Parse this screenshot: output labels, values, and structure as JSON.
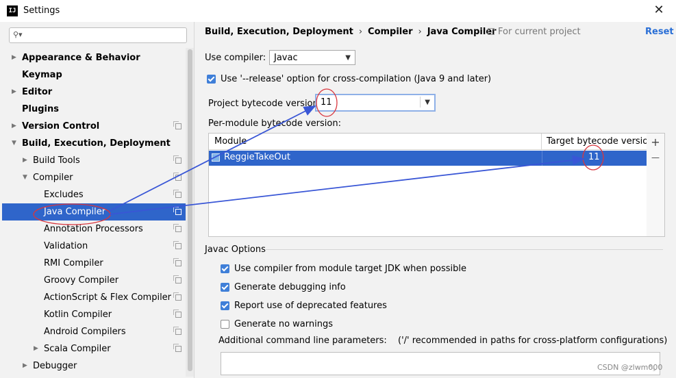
{
  "window": {
    "title": "Settings",
    "app_icon_text": "IJ"
  },
  "sidebar": {
    "search": {
      "placeholder": "",
      "value": ""
    },
    "items": [
      {
        "label": "Appearance & Behavior",
        "arrow": "▶",
        "bold": true
      },
      {
        "label": "Keymap",
        "bold": true
      },
      {
        "label": "Editor",
        "arrow": "▶",
        "bold": true
      },
      {
        "label": "Plugins",
        "bold": true
      },
      {
        "label": "Version Control",
        "arrow": "▶",
        "bold": true
      },
      {
        "label": "Build, Execution, Deployment",
        "arrow": "▼",
        "bold": true
      },
      {
        "label": "Build Tools",
        "arrow": "▶"
      },
      {
        "label": "Compiler",
        "arrow": "▼"
      },
      {
        "label": "Excludes"
      },
      {
        "label": "Java Compiler",
        "selected": true
      },
      {
        "label": "Annotation Processors"
      },
      {
        "label": "Validation"
      },
      {
        "label": "RMI Compiler"
      },
      {
        "label": "Groovy Compiler"
      },
      {
        "label": "ActionScript & Flex Compiler"
      },
      {
        "label": "Kotlin Compiler"
      },
      {
        "label": "Android Compilers"
      },
      {
        "label": "Scala Compiler",
        "arrow": "▶"
      },
      {
        "label": "Debugger",
        "arrow": "▶"
      }
    ]
  },
  "breadcrumb": {
    "items": [
      "Build, Execution, Deployment",
      "Java Compiler"
    ],
    "middle": "Compiler",
    "separator": "›"
  },
  "scope_label": "For current project",
  "reset_label": "Reset",
  "form": {
    "use_compiler_label": "Use compiler:",
    "use_compiler_value": "Javac",
    "release_option_label": "Use '--release' option for cross-compilation (Java 9 and later)",
    "release_option_checked": true,
    "bytecode_label": "Project bytecode version:",
    "bytecode_value": "11",
    "per_module_label": "Per-module bytecode version:"
  },
  "table": {
    "columns": [
      "Module",
      "Target bytecode version"
    ],
    "rows": [
      {
        "module": "ReggieTakeOut",
        "target": "11"
      }
    ],
    "add_label": "+",
    "remove_label": "—"
  },
  "javac": {
    "group_label": "Javac Options",
    "options": [
      {
        "label": "Use compiler from module target JDK when possible",
        "checked": true
      },
      {
        "label": "Generate debugging info",
        "checked": true
      },
      {
        "label": "Report use of deprecated features",
        "checked": true
      },
      {
        "label": "Generate no warnings",
        "checked": false
      }
    ],
    "params_label": "Additional command line parameters:",
    "params_hint": "('/' recommended in paths for cross-platform configurations)",
    "params_value": ""
  },
  "icons": {
    "dropdown": "▼",
    "close": "✕",
    "search": "🔍",
    "resize": "⤡"
  },
  "annotation": {
    "color": "#d9363e",
    "arrow_color": "#3956d6"
  },
  "watermark": "CSDN @zlwm000"
}
